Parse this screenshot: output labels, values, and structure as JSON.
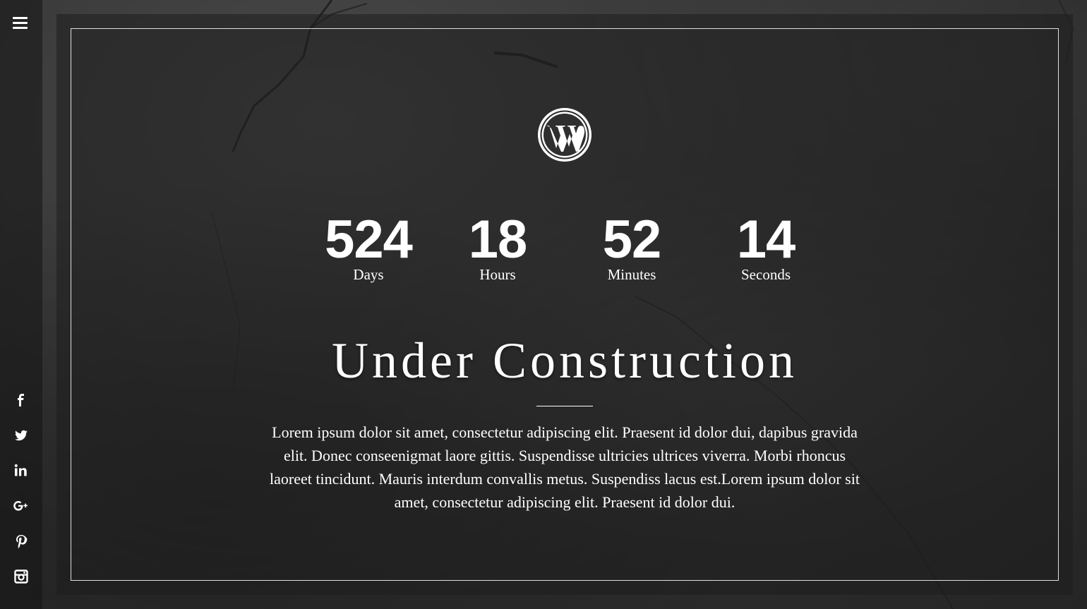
{
  "sidebar": {
    "menu_icon": "hamburger-menu-icon",
    "social": [
      {
        "name": "facebook",
        "icon": "facebook-icon"
      },
      {
        "name": "twitter",
        "icon": "twitter-icon"
      },
      {
        "name": "linkedin",
        "icon": "linkedin-icon"
      },
      {
        "name": "google-plus",
        "icon": "google-plus-icon"
      },
      {
        "name": "pinterest",
        "icon": "pinterest-icon"
      },
      {
        "name": "instagram",
        "icon": "instagram-icon"
      }
    ]
  },
  "logo": {
    "icon": "wordpress-logo-icon"
  },
  "countdown": {
    "days": {
      "value": "524",
      "label": "Days"
    },
    "hours": {
      "value": "18",
      "label": "Hours"
    },
    "minutes": {
      "value": "52",
      "label": "Minutes"
    },
    "seconds": {
      "value": "14",
      "label": "Seconds"
    }
  },
  "heading": "Under Construction",
  "description": "Lorem ipsum dolor sit amet, consectetur adipiscing elit. Praesent id dolor dui, dapibus gravida elit. Donec conseenigmat laore gittis. Suspendisse ultricies ultrices viverra. Morbi rhoncus laoreet tincidunt. Mauris interdum convallis metus. Suspendiss lacus est.Lorem ipsum dolor sit amet, consectetur adipiscing elit. Praesent id dolor dui.",
  "colors": {
    "text": "#ffffff",
    "background": "#2c2c2c",
    "panel": "#1e1e1e"
  }
}
